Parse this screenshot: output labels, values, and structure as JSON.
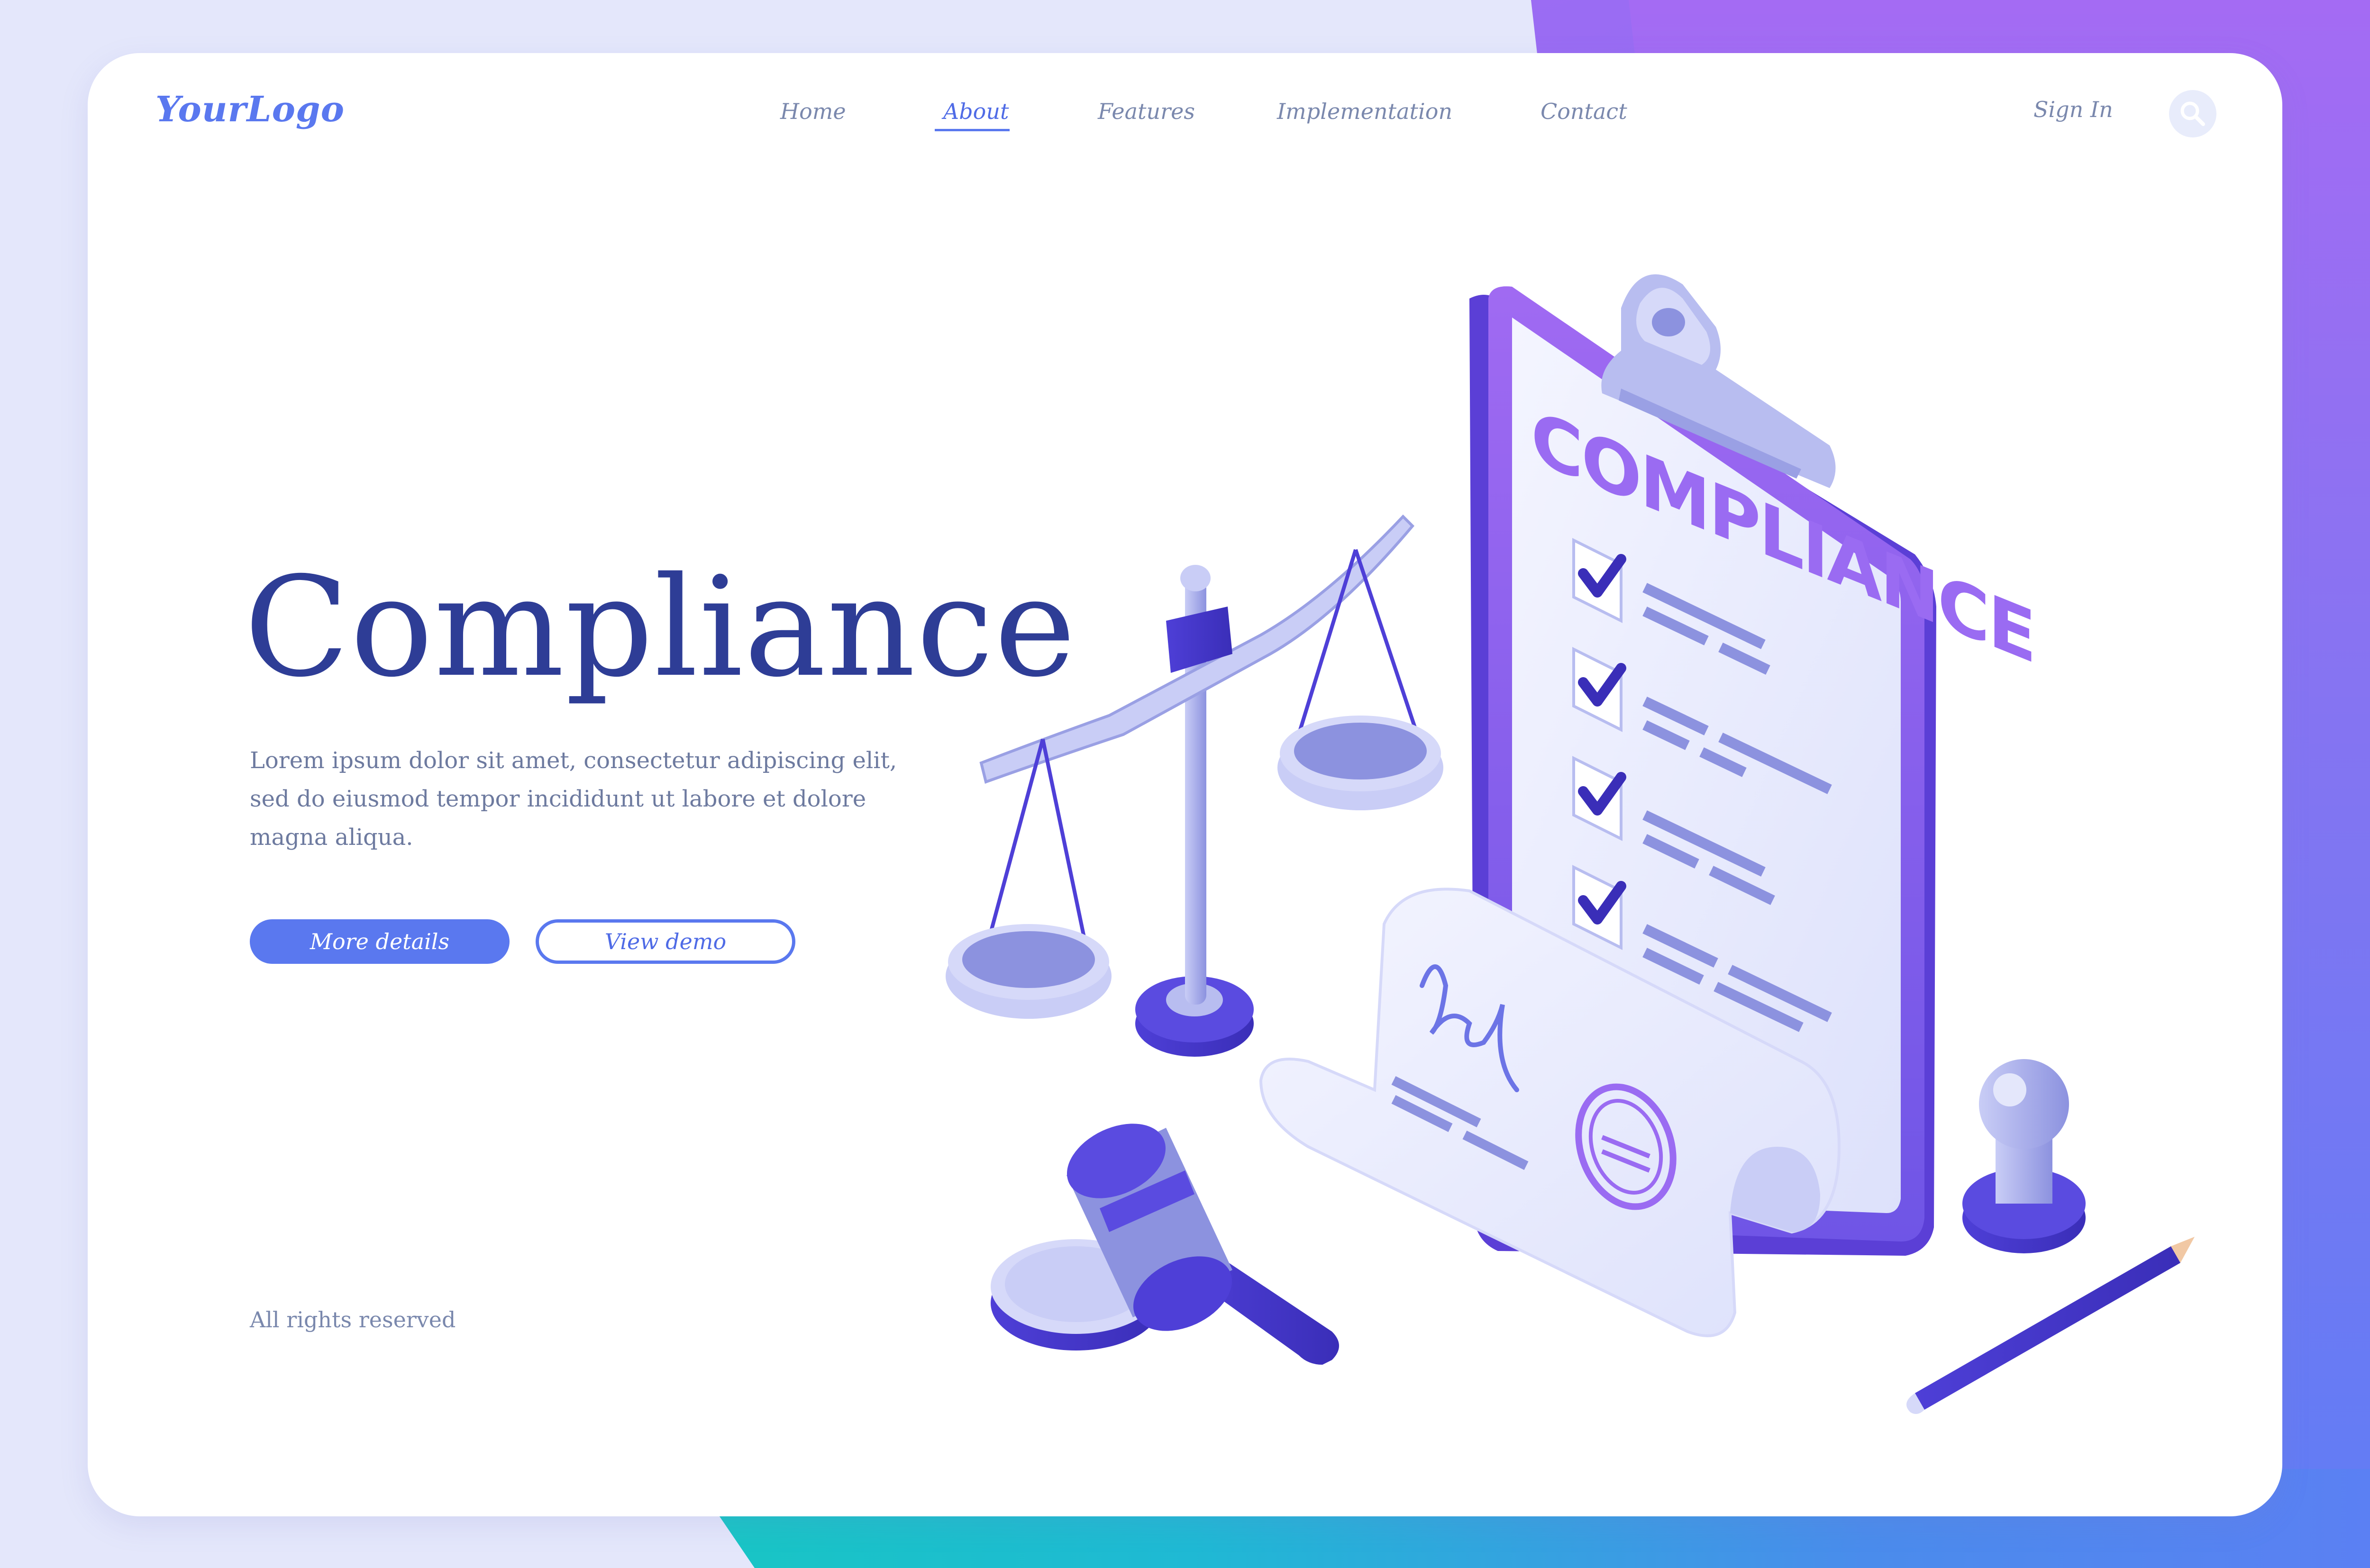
{
  "brand": {
    "logo": "YourLogo"
  },
  "nav": {
    "items": [
      {
        "label": "Home",
        "active": false
      },
      {
        "label": "About",
        "active": true
      },
      {
        "label": "Features",
        "active": false
      },
      {
        "label": "Implementation",
        "active": false
      },
      {
        "label": "Contact",
        "active": false
      }
    ],
    "sign_in": "Sign In",
    "search_icon": "search-icon"
  },
  "hero": {
    "title": "Compliance",
    "description": "Lorem ipsum dolor sit amet, consectetur adipiscing elit, sed do eiusmod tempor incididunt ut labore et dolore magna aliqua.",
    "primary_button": "More details",
    "secondary_button": "View demo"
  },
  "illustration": {
    "clipboard_heading": "COMPLIANCE",
    "checklist_count": 4,
    "icons": [
      "scales-icon",
      "clipboard-icon",
      "document-scroll-icon",
      "gavel-icon",
      "stamp-icon",
      "pencil-icon"
    ]
  },
  "footer": {
    "text": "All rights reserved"
  },
  "colors": {
    "accent": "#5a78ef",
    "title": "#2e3d96",
    "text": "#6d7a9f",
    "purple": "#9a6bf2"
  }
}
